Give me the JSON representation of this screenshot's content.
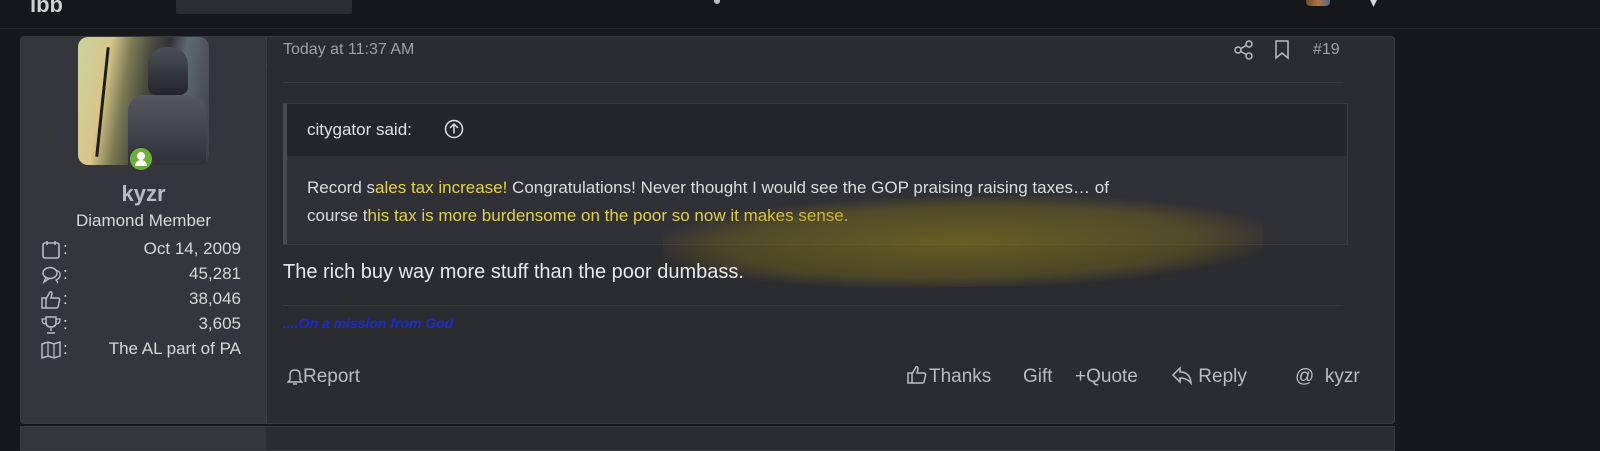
{
  "topbar": {
    "logo_text": "lbb"
  },
  "post": {
    "date": "Today at 11:37 AM",
    "number": "#19",
    "user": {
      "name": "kyzr",
      "title": "Diamond Member",
      "stats": [
        {
          "icon": "calendar-icon",
          "value": "Oct 14, 2009"
        },
        {
          "icon": "messages-icon",
          "value": "45,281"
        },
        {
          "icon": "thumbs-up-icon",
          "value": "38,046"
        },
        {
          "icon": "trophy-icon",
          "value": "3,605"
        },
        {
          "icon": "map-icon",
          "value": "The AL part of PA"
        }
      ]
    },
    "quote": {
      "author": "citygator said:",
      "line1_pre": "Record s",
      "line1_hl": "ales tax increase!",
      "line1_post": " Congratulations! Never thought I would see the GOP praising raising taxes… of",
      "line2_pre": "course t",
      "line2_hl": "his tax is more burdensome on the poor so now it makes sense."
    },
    "message": "The rich buy way more stuff than the poor dumbass.",
    "signature": "....On a mission from God",
    "actions": {
      "report": "Report",
      "thanks": "Thanks",
      "gift": "Gift",
      "quote": "Quote",
      "reply": "Reply",
      "mention": "kyzr"
    }
  },
  "colors": {
    "background": "#17181b",
    "post_bg": "#2b2c30",
    "user_panel_bg": "#35363b",
    "highlight_text": "#e4d04a",
    "signature": "#1b2ad4",
    "online": "#6fb03a"
  }
}
